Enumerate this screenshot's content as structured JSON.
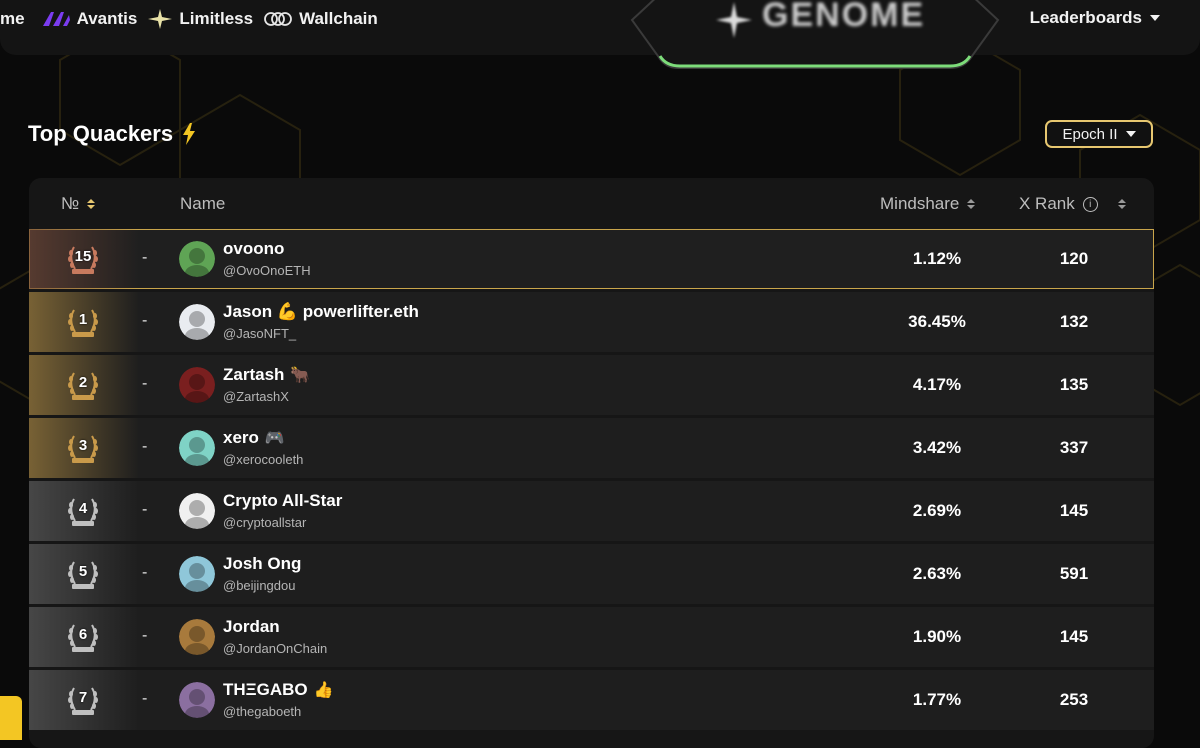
{
  "nav": {
    "left_fragment": "me",
    "partners": [
      {
        "label": "Avantis",
        "icon": "avantis-logo-icon"
      },
      {
        "label": "Limitless",
        "icon": "limitless-logo-icon"
      },
      {
        "label": "Wallchain",
        "icon": "wallchain-logo-icon"
      }
    ],
    "logo_text": "GENOME",
    "leaderboards_label": "Leaderboards"
  },
  "section": {
    "title": "Top Quackers",
    "title_icon": "lightning-bolt-icon"
  },
  "epoch": {
    "selected": "Epoch II"
  },
  "table": {
    "headers": {
      "rank": "№",
      "name": "Name",
      "mindshare": "Mindshare",
      "xrank": "X Rank"
    },
    "rows": [
      {
        "rank": "15",
        "change": "-",
        "name": "ovoono",
        "emoji": "",
        "handle": "@OvoOnoETH",
        "mindshare": "1.12%",
        "xrank": "120",
        "tier": "current",
        "avatar_color": "#5fa455"
      },
      {
        "rank": "1",
        "change": "-",
        "name": "Jason 💪 powerlifter.eth",
        "emoji": "",
        "handle": "@JasoNFT_",
        "mindshare": "36.45%",
        "xrank": "132",
        "tier": "gold",
        "avatar_color": "#e9ecf0"
      },
      {
        "rank": "2",
        "change": "-",
        "name": "Zartash",
        "emoji": "🐂",
        "handle": "@ZartashX",
        "mindshare": "4.17%",
        "xrank": "135",
        "tier": "gold",
        "avatar_color": "#7a1f1f"
      },
      {
        "rank": "3",
        "change": "-",
        "name": "xero",
        "emoji": "🎮",
        "handle": "@xerocooleth",
        "mindshare": "3.42%",
        "xrank": "337",
        "tier": "gold",
        "avatar_color": "#7fd3c6"
      },
      {
        "rank": "4",
        "change": "-",
        "name": "Crypto All-Star",
        "emoji": "",
        "handle": "@cryptoallstar",
        "mindshare": "2.69%",
        "xrank": "145",
        "tier": "silver",
        "avatar_color": "#f0f0f0"
      },
      {
        "rank": "5",
        "change": "-",
        "name": "Josh Ong",
        "emoji": "",
        "handle": "@beijingdou",
        "mindshare": "2.63%",
        "xrank": "591",
        "tier": "silver",
        "avatar_color": "#8fc7d9"
      },
      {
        "rank": "6",
        "change": "-",
        "name": "Jordan",
        "emoji": "",
        "handle": "@JordanOnChain",
        "mindshare": "1.90%",
        "xrank": "145",
        "tier": "silver",
        "avatar_color": "#a87a3c"
      },
      {
        "rank": "7",
        "change": "-",
        "name": "THΞGABO",
        "emoji": "👍",
        "handle": "@thegaboeth",
        "mindshare": "1.77%",
        "xrank": "253",
        "tier": "silver",
        "avatar_color": "#8b6fa0"
      }
    ]
  },
  "colors": {
    "accent_gold": "#e7c770",
    "background": "#0a0a0a",
    "row_bg": "#1e1e1e",
    "logo_glow": "#7ddc7a"
  }
}
